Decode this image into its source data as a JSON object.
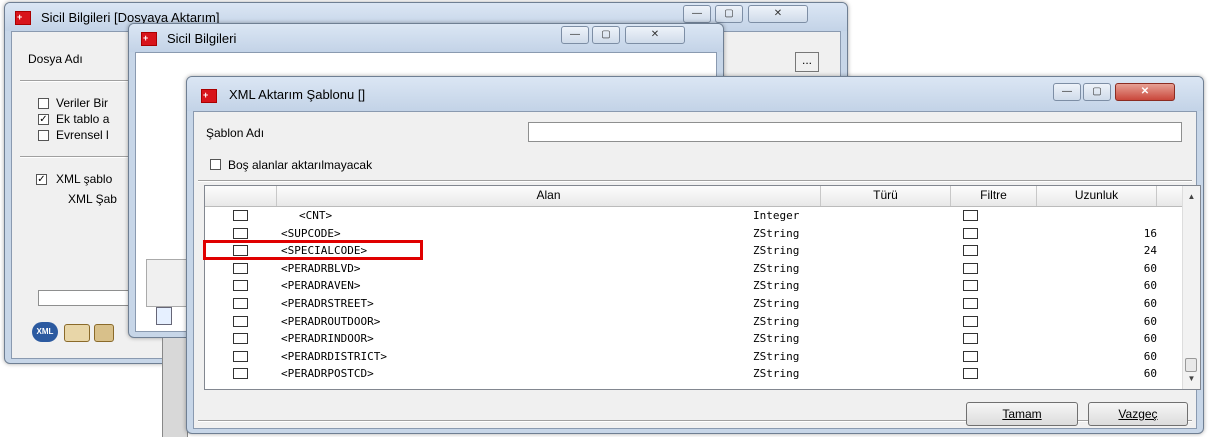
{
  "win1": {
    "title": "Sicil Bilgileri [Dosyaya Aktarım]",
    "dosya_adi_label": "Dosya Adı",
    "browse_label": "...",
    "checks": [
      {
        "label": "Veriler Bir",
        "checked": false
      },
      {
        "label": "Ek tablo a",
        "checked": true
      },
      {
        "label": "Evrensel l",
        "checked": false
      }
    ],
    "xml_check": {
      "label": "XML şablo",
      "checked": true
    },
    "xml_sablon_label": "XML Şab",
    "btn_xml": "XML"
  },
  "win2": {
    "title": "Sicil Bilgileri"
  },
  "dialog": {
    "title": "XML Aktarım Şablonu []",
    "sablon_adi_label": "Şablon Adı",
    "sablon_adi_value": "",
    "bos_alanlar_label": "Boş alanlar aktarılmayacak",
    "columns": {
      "alan": "Alan",
      "turu": "Türü",
      "filtre": "Filtre",
      "uzunluk": "Uzunluk"
    },
    "rows": [
      {
        "alan": "<CNT>",
        "turu": "Integer",
        "uzunluk": ""
      },
      {
        "alan": "<SUPCODE>",
        "turu": "ZString",
        "uzunluk": "16"
      },
      {
        "alan": "<SPECIALCODE>",
        "turu": "ZString",
        "uzunluk": "24"
      },
      {
        "alan": "<PERADRBLVD>",
        "turu": "ZString",
        "uzunluk": "60"
      },
      {
        "alan": "<PERADRAVEN>",
        "turu": "ZString",
        "uzunluk": "60"
      },
      {
        "alan": "<PERADRSTREET>",
        "turu": "ZString",
        "uzunluk": "60"
      },
      {
        "alan": "<PERADROUTDOOR>",
        "turu": "ZString",
        "uzunluk": "60"
      },
      {
        "alan": "<PERADRINDOOR>",
        "turu": "ZString",
        "uzunluk": "60"
      },
      {
        "alan": "<PERADRDISTRICT>",
        "turu": "ZString",
        "uzunluk": "60"
      },
      {
        "alan": "<PERADRPOSTCD>",
        "turu": "ZString",
        "uzunluk": "60"
      }
    ],
    "ok_label": "Tamam",
    "cancel_label": "Vazgeç"
  },
  "colors": {
    "highlight": "#e00000",
    "close_red": "#c9473b",
    "window_frame": "#c7d6e8"
  }
}
